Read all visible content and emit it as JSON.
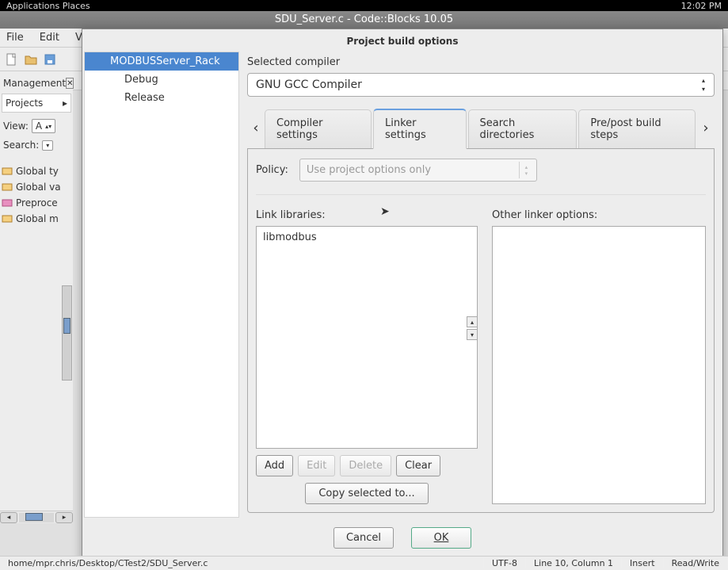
{
  "top_panel": {
    "left": "Applications   Places",
    "right": "12:02 PM"
  },
  "title_bar": "SDU_Server.c - Code::Blocks 10.05",
  "menu": [
    "File",
    "Edit",
    "Vie"
  ],
  "side": {
    "management": "Management",
    "projects_tab": "Projects",
    "view_label": "View:",
    "view_val": "A",
    "search_label": "Search:",
    "tree": [
      "Global ty",
      "Global va",
      "Preproce",
      "Global m"
    ]
  },
  "dialog": {
    "title": "Project build options",
    "tree": {
      "root": "MODBUSServer_Rack",
      "children": [
        "Debug",
        "Release"
      ]
    },
    "selected_compiler_label": "Selected compiler",
    "compiler_value": "GNU GCC Compiler",
    "tabs": [
      "Compiler settings",
      "Linker settings",
      "Search directories",
      "Pre/post build steps"
    ],
    "active_tab": 1,
    "policy_label": "Policy:",
    "policy_value": "Use project options only",
    "link_libs_label": "Link libraries:",
    "link_libs": [
      "libmodbus"
    ],
    "other_linker_label": "Other linker options:",
    "btns": {
      "add": "Add",
      "edit": "Edit",
      "delete": "Delete",
      "clear": "Clear",
      "copy": "Copy selected to..."
    },
    "cancel": "Cancel",
    "ok": "OK"
  },
  "status": {
    "path": "home/mpr.chris/Desktop/CTest2/SDU_Server.c",
    "enc": "UTF-8",
    "pos": "Line 10, Column 1",
    "ins": "Insert",
    "rw": "Read/Write"
  }
}
